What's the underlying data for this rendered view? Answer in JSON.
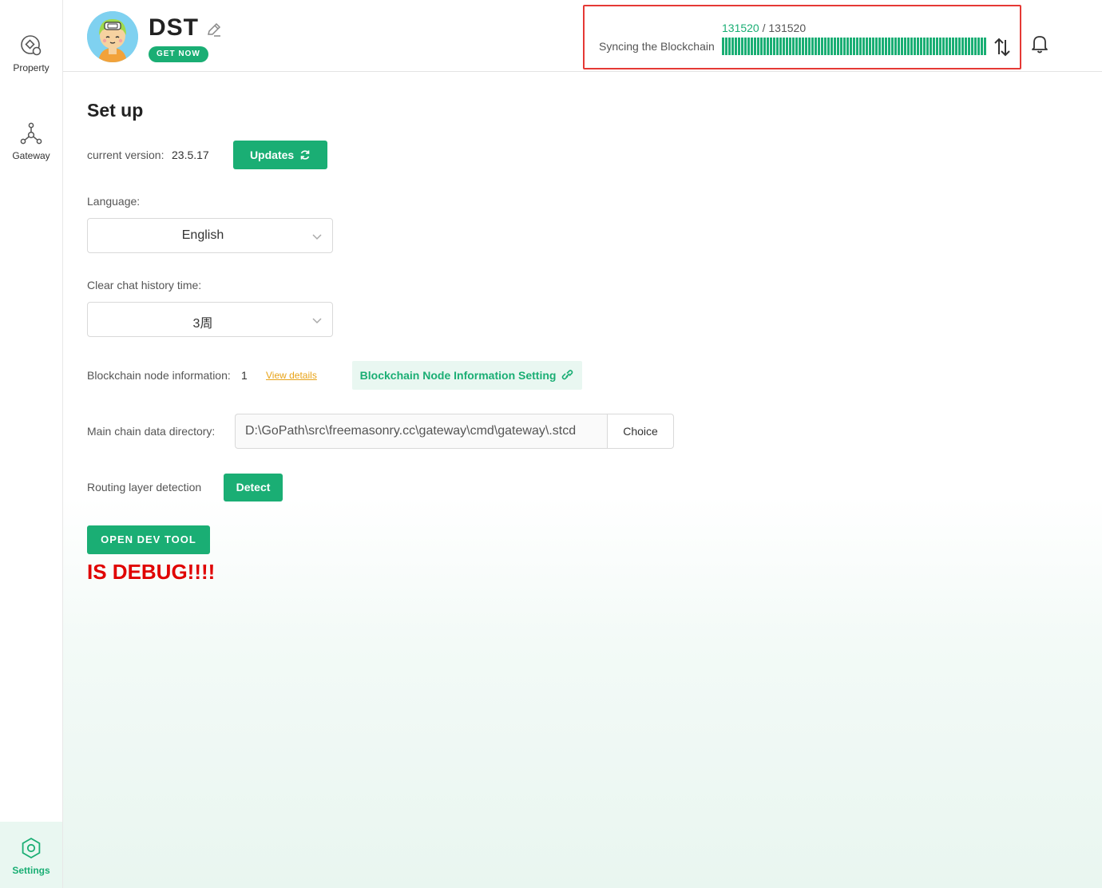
{
  "sidebar": {
    "items": [
      {
        "label": "Property",
        "icon": "property-icon"
      },
      {
        "label": "Gateway",
        "icon": "gateway-icon"
      },
      {
        "label": "Settings",
        "icon": "settings-icon"
      }
    ]
  },
  "header": {
    "username": "DST",
    "get_now_label": "GET NOW",
    "sync": {
      "current": "131520",
      "separator": "/",
      "total": "131520",
      "label": "Syncing the Blockchain",
      "progress": 1.0
    }
  },
  "main": {
    "title": "Set up",
    "version": {
      "label": "current version:",
      "value": "23.5.17",
      "button": "Updates"
    },
    "language": {
      "label": "Language:",
      "value": "English"
    },
    "clear_history": {
      "label": "Clear chat history time:",
      "value": "3周"
    },
    "node_info": {
      "label": "Blockchain node information:",
      "value": "1",
      "link": "View details",
      "setting_button": "Blockchain Node Information Setting"
    },
    "data_dir": {
      "label": "Main chain data directory:",
      "value": "D:\\GoPath\\src\\freemasonry.cc\\gateway\\cmd\\gateway\\.stcd",
      "button": "Choice"
    },
    "routing": {
      "label": "Routing layer detection",
      "button": "Detect"
    },
    "dev_tool_button": "OPEN DEV TOOL",
    "debug_text": "IS DEBUG!!!!"
  },
  "colors": {
    "accent": "#1aae74",
    "accent_light": "#e9f7f1",
    "highlight_border": "#e53935",
    "debug": "#e00000",
    "link": "#e8a317"
  }
}
